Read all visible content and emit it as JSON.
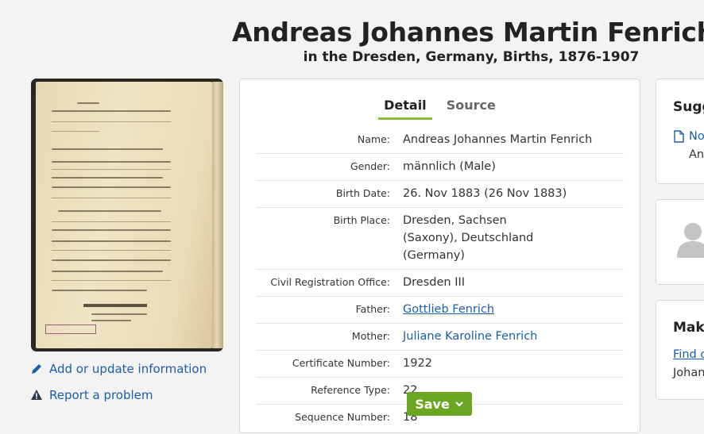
{
  "header": {
    "title": "Andreas Johannes Martin Fenrich",
    "subtitle": "in the Dresden, Germany, Births, 1876-1907"
  },
  "left": {
    "add_link": "Add or update information",
    "report_link": "Report a problem"
  },
  "tabs": [
    {
      "label": "Detail",
      "active": true
    },
    {
      "label": "Source",
      "active": false
    }
  ],
  "details": [
    {
      "label": "Name:",
      "value": "Andreas Johannes Martin Fenrich"
    },
    {
      "label": "Gender:",
      "value": "männlich (Male)"
    },
    {
      "label": "Birth Date:",
      "value": "26. Nov 1883 (26 Nov 1883)"
    },
    {
      "label": "Birth Place:",
      "value": "Dresden, Sachsen (Saxony), Deutschland (Germany)"
    },
    {
      "label": "Civil Registration Office:",
      "value": "Dresden III"
    },
    {
      "label": "Father:",
      "value": "Gottlieb Fenrich"
    },
    {
      "label": "Mother:",
      "value": "Juliane Karoline Fenrich"
    },
    {
      "label": "Certificate Number:",
      "value": "1922"
    },
    {
      "label": "Reference Type:",
      "value": "22"
    },
    {
      "label": "Sequence Number:",
      "value": "18"
    }
  ],
  "save_label": "Save",
  "right": {
    "suggestions_title": "Sugg",
    "suggestion_link": "No",
    "suggestion_sub": "And",
    "make_title": "Make",
    "find_link": "Find o",
    "make_sub": "Johan"
  },
  "colors": {
    "link": "#1a5ea8",
    "save_green": "#6aa621",
    "tab_underline": "#8bbd3a"
  }
}
